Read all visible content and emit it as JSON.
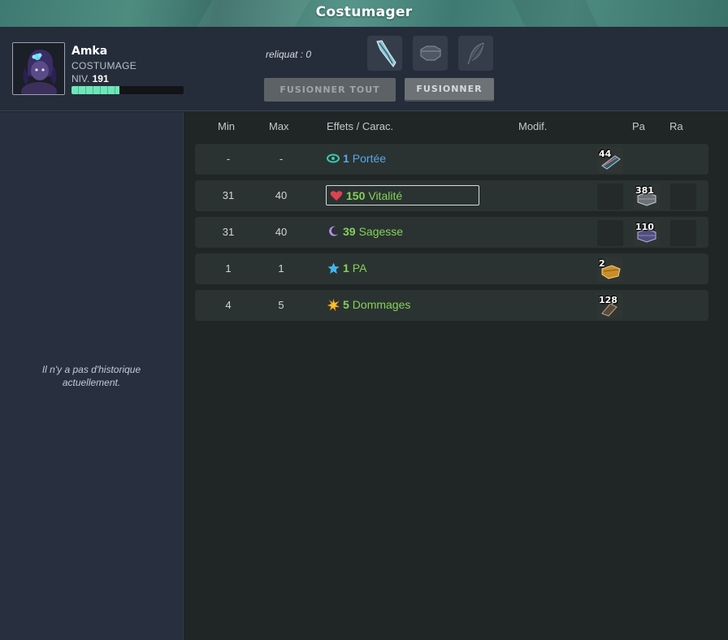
{
  "window": {
    "title": "Costumager"
  },
  "character": {
    "name": "Amka",
    "job": "COSTUMAGE",
    "level_label": "NIV.",
    "level": "191",
    "xp_progress": 0.43
  },
  "toolbar": {
    "reliquat": "reliquat : 0",
    "fuse_all_label": "FUSIONNER TOUT",
    "fuse_label": "FUSIONNER",
    "slots": [
      "crystal-shard-icon",
      "hexagon-stone-icon",
      "feather-icon"
    ]
  },
  "history": {
    "empty_text": "Il n'y a pas d'historique actuellement."
  },
  "table": {
    "columns": {
      "min": "Min",
      "max": "Max",
      "effects": "Effets / Carac.",
      "modif": "Modif.",
      "pa": "Pa",
      "ra": "Ra"
    },
    "rows": [
      {
        "min": "-",
        "max": "-",
        "value": "1",
        "stat": "Portée",
        "icon": "eye-icon",
        "color": "#5aa6e6",
        "rune_count": "44"
      },
      {
        "min": "31",
        "max": "40",
        "value": "150",
        "stat": "Vitalité",
        "icon": "heart-icon",
        "color": "#86d15a",
        "rune_count": "381"
      },
      {
        "min": "31",
        "max": "40",
        "value": "39",
        "stat": "Sagesse",
        "icon": "moon-icon",
        "color": "#86d15a",
        "rune_count": "110"
      },
      {
        "min": "1",
        "max": "1",
        "value": "1",
        "stat": "PA",
        "icon": "star-icon",
        "color": "#86d15a",
        "rune_count": "2"
      },
      {
        "min": "4",
        "max": "5",
        "value": "5",
        "stat": "Dommages",
        "icon": "burst-icon",
        "color": "#86d15a",
        "rune_count": "128"
      }
    ]
  }
}
